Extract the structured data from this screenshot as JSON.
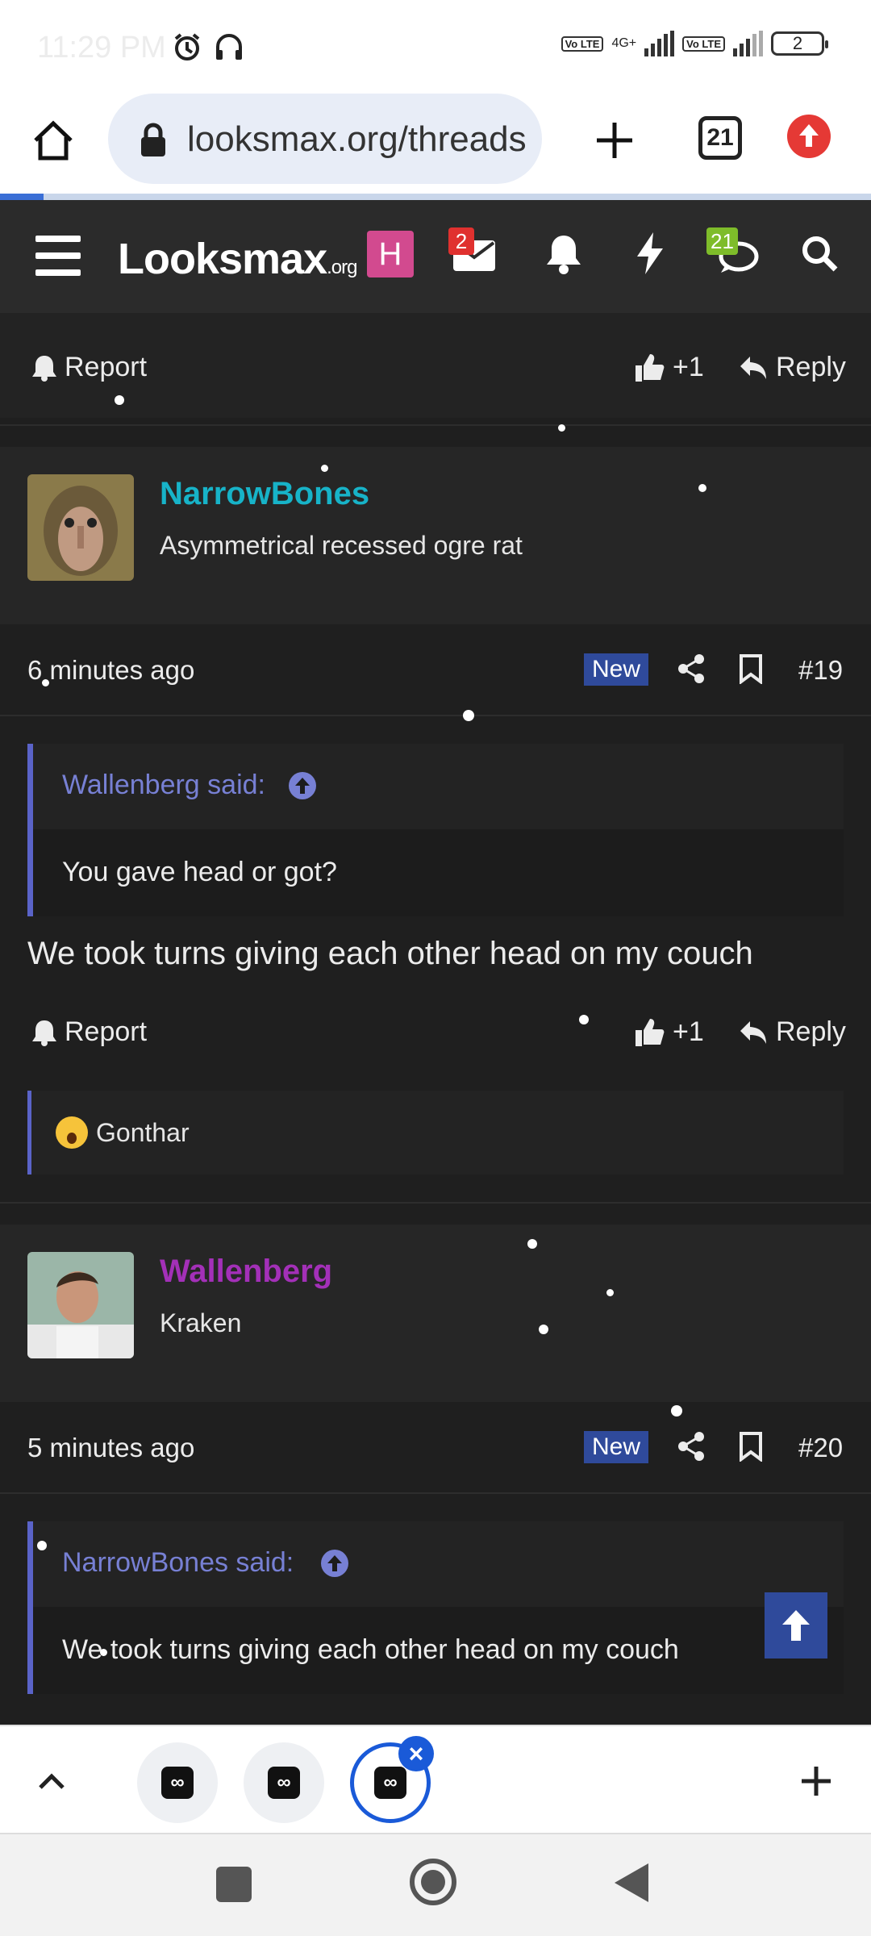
{
  "status": {
    "time": "11:29 PM",
    "lte1": "Vo LTE",
    "net": "4G+",
    "lte2": "Vo LTE",
    "battery": "2"
  },
  "browser": {
    "url": "looksmax.org/threads",
    "tab_count": "21"
  },
  "site": {
    "logo_main": "Looksmax",
    "logo_suffix": ".org",
    "avatar_letter": "H",
    "inbox_badge": "2",
    "alerts_badge": "21"
  },
  "post_top": {
    "report": "Report",
    "like": "+1",
    "reply": "Reply"
  },
  "post19": {
    "username": "NarrowBones",
    "user_color": "#17b3c8",
    "user_title": "Asymmetrical recessed ogre rat",
    "time": "6 minutes ago",
    "new": "New",
    "number": "#19",
    "quote_author": "Wallenberg said:",
    "quote_text": "You gave head or got?",
    "message": "We took turns giving each other head on my couch",
    "report": "Report",
    "like": "+1",
    "reply": "Reply",
    "reaction_user": "Gonthar"
  },
  "post20": {
    "username": "Wallenberg",
    "user_color": "#a330b8",
    "user_title": "Kraken",
    "time": "5 minutes ago",
    "new": "New",
    "number": "#20",
    "quote_author": "NarrowBones said:",
    "quote_text": "We took turns giving each other head on my couch"
  }
}
